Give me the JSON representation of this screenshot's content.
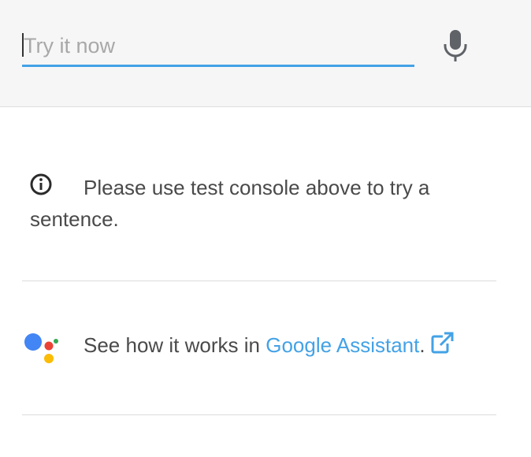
{
  "input": {
    "placeholder": "Try it now",
    "value": ""
  },
  "icons": {
    "mic": "microphone-icon",
    "info": "info-icon",
    "assistant": "google-assistant-logo",
    "external": "external-link-icon"
  },
  "info": {
    "message": "Please use test console above to try a sentence."
  },
  "assistant": {
    "prefix": "See how it works in ",
    "link_label": "Google Assistant",
    "suffix": "."
  },
  "colors": {
    "accent": "#43a2e6",
    "topbar_bg": "#f6f6f6",
    "assistant_blue": "#4285f4",
    "assistant_red": "#ea4335",
    "assistant_yellow": "#fbbc05",
    "assistant_green": "#34a853"
  }
}
